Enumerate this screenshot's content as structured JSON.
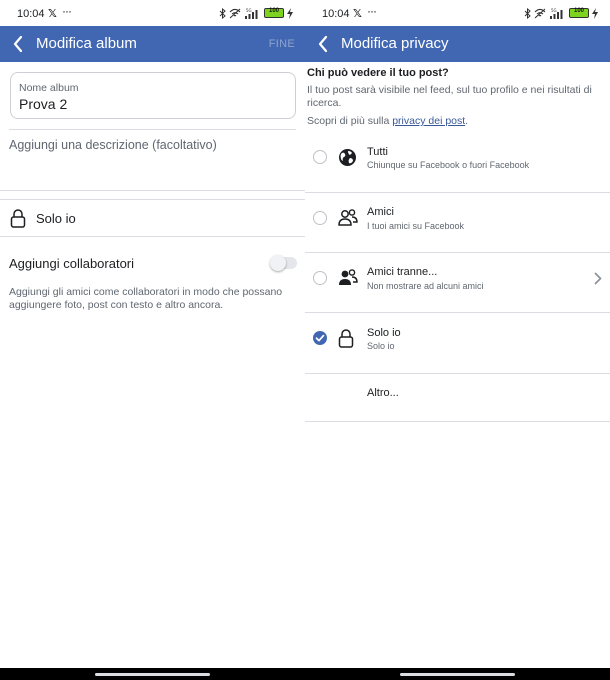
{
  "status": {
    "time": "10:04",
    "x_glyph": "𝕏",
    "dots": "···",
    "battery": "100"
  },
  "left": {
    "title": "Modifica album",
    "done": "FINE",
    "name_label": "Nome album",
    "name_value": "Prova 2",
    "description_placeholder": "Aggiungi una descrizione (facoltativo)",
    "privacy": "Solo io",
    "collab_title": "Aggiungi collaboratori",
    "collab_desc": "Aggiungi gli amici come collaboratori in modo che possano aggiungere foto, post con testo e altro ancora."
  },
  "right": {
    "title": "Modifica privacy",
    "question": "Chi può vedere il tuo post?",
    "description": "Il tuo post sarà visibile nel feed, sul tuo profilo e nei risultati di ricerca.",
    "more_prefix": "Scopri di più sulla ",
    "more_link": "privacy dei post",
    "more_suffix": ".",
    "options": [
      {
        "title": "Tutti",
        "subtitle": "Chiunque su Facebook o fuori Facebook",
        "icon": "globe-icon",
        "selected": false
      },
      {
        "title": "Amici",
        "subtitle": "I tuoi amici su Facebook",
        "icon": "friends-icon",
        "selected": false
      },
      {
        "title": "Amici tranne...",
        "subtitle": "Non mostrare ad alcuni amici",
        "icon": "friends-except-icon",
        "selected": false
      },
      {
        "title": "Solo io",
        "subtitle": "Solo io",
        "icon": "lock-icon",
        "selected": true
      }
    ],
    "more_options": "Altro..."
  },
  "colors": {
    "appbar": "#4267b2",
    "accent": "#4267b2",
    "link": "#385898"
  }
}
